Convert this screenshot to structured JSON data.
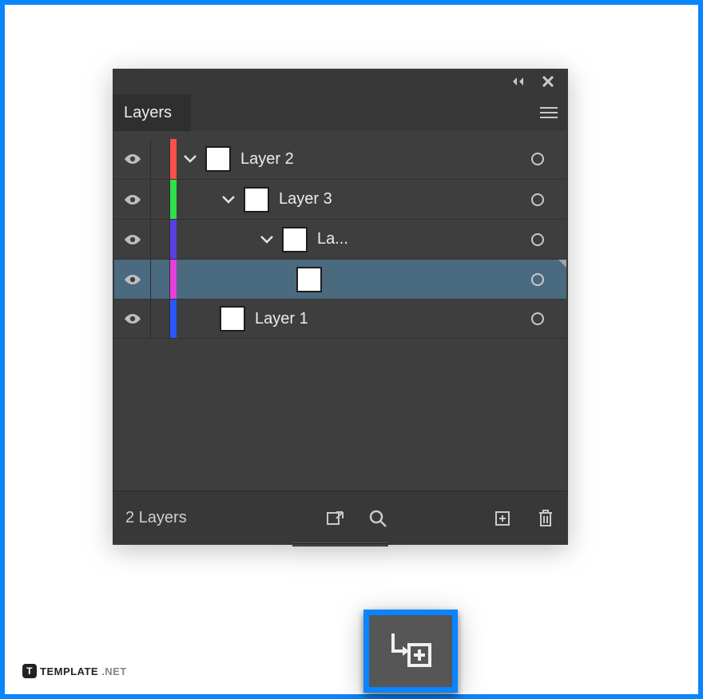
{
  "panel": {
    "title": "Layers",
    "footer_count": "2 Layers"
  },
  "layers": [
    {
      "name": "Layer 2",
      "color": "#ff4d4d",
      "indent": 0,
      "has_children": true,
      "expanded": true,
      "selected": false
    },
    {
      "name": "Layer 3",
      "color": "#2ee04b",
      "indent": 1,
      "has_children": true,
      "expanded": true,
      "selected": false
    },
    {
      "name": "La...",
      "color": "#5a3fe0",
      "indent": 2,
      "has_children": true,
      "expanded": true,
      "selected": false
    },
    {
      "name": "",
      "color": "#e53fd9",
      "indent": 3,
      "has_children": false,
      "expanded": false,
      "selected": true
    },
    {
      "name": "Layer 1",
      "color": "#2c57ff",
      "indent": 1,
      "has_children": false,
      "expanded": false,
      "selected": false
    }
  ],
  "footer_icons": {
    "collect": "collect-for-export-icon",
    "locate": "locate-object-icon",
    "new_sublayer": "new-sublayer-icon",
    "new_layer": "new-layer-icon",
    "delete": "delete-layer-icon"
  },
  "watermark": {
    "badge": "T",
    "text": "TEMPLATE",
    "suffix": ".NET"
  }
}
